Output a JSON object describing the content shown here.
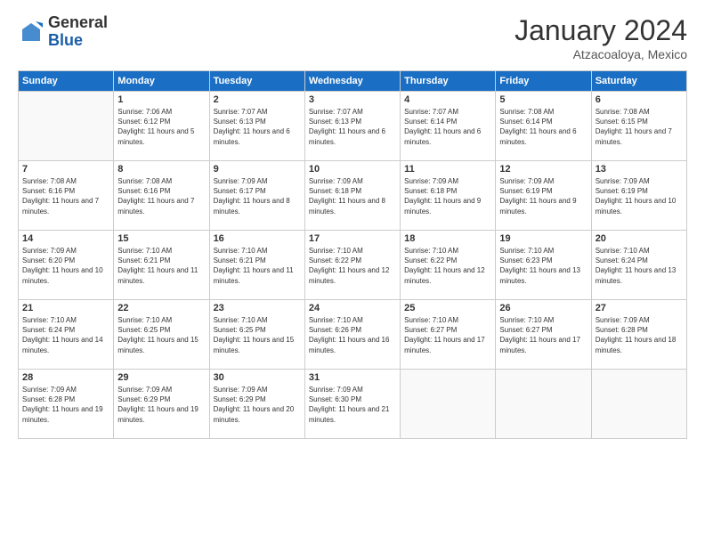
{
  "logo": {
    "general": "General",
    "blue": "Blue"
  },
  "title": "January 2024",
  "location": "Atzacoaloya, Mexico",
  "weekdays": [
    "Sunday",
    "Monday",
    "Tuesday",
    "Wednesday",
    "Thursday",
    "Friday",
    "Saturday"
  ],
  "weeks": [
    [
      {
        "day": "",
        "sunrise": "",
        "sunset": "",
        "daylight": ""
      },
      {
        "day": "1",
        "sunrise": "Sunrise: 7:06 AM",
        "sunset": "Sunset: 6:12 PM",
        "daylight": "Daylight: 11 hours and 5 minutes."
      },
      {
        "day": "2",
        "sunrise": "Sunrise: 7:07 AM",
        "sunset": "Sunset: 6:13 PM",
        "daylight": "Daylight: 11 hours and 6 minutes."
      },
      {
        "day": "3",
        "sunrise": "Sunrise: 7:07 AM",
        "sunset": "Sunset: 6:13 PM",
        "daylight": "Daylight: 11 hours and 6 minutes."
      },
      {
        "day": "4",
        "sunrise": "Sunrise: 7:07 AM",
        "sunset": "Sunset: 6:14 PM",
        "daylight": "Daylight: 11 hours and 6 minutes."
      },
      {
        "day": "5",
        "sunrise": "Sunrise: 7:08 AM",
        "sunset": "Sunset: 6:14 PM",
        "daylight": "Daylight: 11 hours and 6 minutes."
      },
      {
        "day": "6",
        "sunrise": "Sunrise: 7:08 AM",
        "sunset": "Sunset: 6:15 PM",
        "daylight": "Daylight: 11 hours and 7 minutes."
      }
    ],
    [
      {
        "day": "7",
        "sunrise": "Sunrise: 7:08 AM",
        "sunset": "Sunset: 6:16 PM",
        "daylight": "Daylight: 11 hours and 7 minutes."
      },
      {
        "day": "8",
        "sunrise": "Sunrise: 7:08 AM",
        "sunset": "Sunset: 6:16 PM",
        "daylight": "Daylight: 11 hours and 7 minutes."
      },
      {
        "day": "9",
        "sunrise": "Sunrise: 7:09 AM",
        "sunset": "Sunset: 6:17 PM",
        "daylight": "Daylight: 11 hours and 8 minutes."
      },
      {
        "day": "10",
        "sunrise": "Sunrise: 7:09 AM",
        "sunset": "Sunset: 6:18 PM",
        "daylight": "Daylight: 11 hours and 8 minutes."
      },
      {
        "day": "11",
        "sunrise": "Sunrise: 7:09 AM",
        "sunset": "Sunset: 6:18 PM",
        "daylight": "Daylight: 11 hours and 9 minutes."
      },
      {
        "day": "12",
        "sunrise": "Sunrise: 7:09 AM",
        "sunset": "Sunset: 6:19 PM",
        "daylight": "Daylight: 11 hours and 9 minutes."
      },
      {
        "day": "13",
        "sunrise": "Sunrise: 7:09 AM",
        "sunset": "Sunset: 6:19 PM",
        "daylight": "Daylight: 11 hours and 10 minutes."
      }
    ],
    [
      {
        "day": "14",
        "sunrise": "Sunrise: 7:09 AM",
        "sunset": "Sunset: 6:20 PM",
        "daylight": "Daylight: 11 hours and 10 minutes."
      },
      {
        "day": "15",
        "sunrise": "Sunrise: 7:10 AM",
        "sunset": "Sunset: 6:21 PM",
        "daylight": "Daylight: 11 hours and 11 minutes."
      },
      {
        "day": "16",
        "sunrise": "Sunrise: 7:10 AM",
        "sunset": "Sunset: 6:21 PM",
        "daylight": "Daylight: 11 hours and 11 minutes."
      },
      {
        "day": "17",
        "sunrise": "Sunrise: 7:10 AM",
        "sunset": "Sunset: 6:22 PM",
        "daylight": "Daylight: 11 hours and 12 minutes."
      },
      {
        "day": "18",
        "sunrise": "Sunrise: 7:10 AM",
        "sunset": "Sunset: 6:22 PM",
        "daylight": "Daylight: 11 hours and 12 minutes."
      },
      {
        "day": "19",
        "sunrise": "Sunrise: 7:10 AM",
        "sunset": "Sunset: 6:23 PM",
        "daylight": "Daylight: 11 hours and 13 minutes."
      },
      {
        "day": "20",
        "sunrise": "Sunrise: 7:10 AM",
        "sunset": "Sunset: 6:24 PM",
        "daylight": "Daylight: 11 hours and 13 minutes."
      }
    ],
    [
      {
        "day": "21",
        "sunrise": "Sunrise: 7:10 AM",
        "sunset": "Sunset: 6:24 PM",
        "daylight": "Daylight: 11 hours and 14 minutes."
      },
      {
        "day": "22",
        "sunrise": "Sunrise: 7:10 AM",
        "sunset": "Sunset: 6:25 PM",
        "daylight": "Daylight: 11 hours and 15 minutes."
      },
      {
        "day": "23",
        "sunrise": "Sunrise: 7:10 AM",
        "sunset": "Sunset: 6:25 PM",
        "daylight": "Daylight: 11 hours and 15 minutes."
      },
      {
        "day": "24",
        "sunrise": "Sunrise: 7:10 AM",
        "sunset": "Sunset: 6:26 PM",
        "daylight": "Daylight: 11 hours and 16 minutes."
      },
      {
        "day": "25",
        "sunrise": "Sunrise: 7:10 AM",
        "sunset": "Sunset: 6:27 PM",
        "daylight": "Daylight: 11 hours and 17 minutes."
      },
      {
        "day": "26",
        "sunrise": "Sunrise: 7:10 AM",
        "sunset": "Sunset: 6:27 PM",
        "daylight": "Daylight: 11 hours and 17 minutes."
      },
      {
        "day": "27",
        "sunrise": "Sunrise: 7:09 AM",
        "sunset": "Sunset: 6:28 PM",
        "daylight": "Daylight: 11 hours and 18 minutes."
      }
    ],
    [
      {
        "day": "28",
        "sunrise": "Sunrise: 7:09 AM",
        "sunset": "Sunset: 6:28 PM",
        "daylight": "Daylight: 11 hours and 19 minutes."
      },
      {
        "day": "29",
        "sunrise": "Sunrise: 7:09 AM",
        "sunset": "Sunset: 6:29 PM",
        "daylight": "Daylight: 11 hours and 19 minutes."
      },
      {
        "day": "30",
        "sunrise": "Sunrise: 7:09 AM",
        "sunset": "Sunset: 6:29 PM",
        "daylight": "Daylight: 11 hours and 20 minutes."
      },
      {
        "day": "31",
        "sunrise": "Sunrise: 7:09 AM",
        "sunset": "Sunset: 6:30 PM",
        "daylight": "Daylight: 11 hours and 21 minutes."
      },
      {
        "day": "",
        "sunrise": "",
        "sunset": "",
        "daylight": ""
      },
      {
        "day": "",
        "sunrise": "",
        "sunset": "",
        "daylight": ""
      },
      {
        "day": "",
        "sunrise": "",
        "sunset": "",
        "daylight": ""
      }
    ]
  ]
}
